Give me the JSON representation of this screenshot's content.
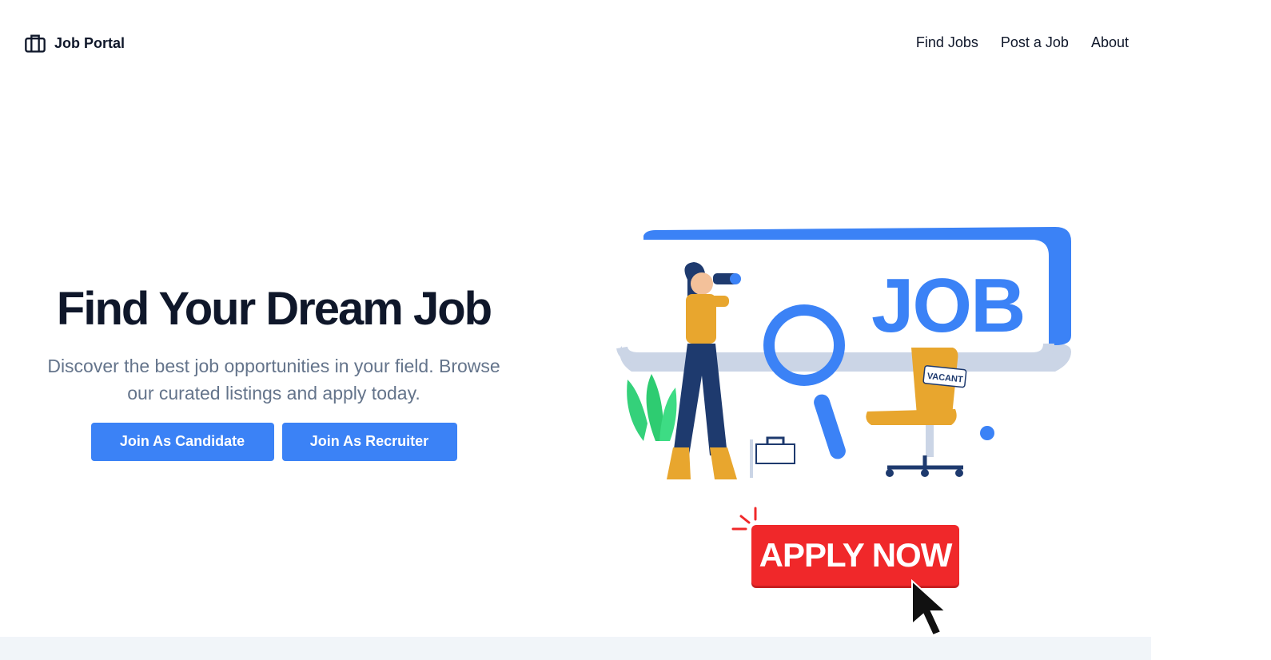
{
  "brand": {
    "name": "Job Portal",
    "icon": "briefcase-icon"
  },
  "nav": {
    "items": [
      "Find Jobs",
      "Post a Job",
      "About"
    ]
  },
  "hero": {
    "title": "Find Your Dream Job",
    "subtitle_line1": "Discover the best job opportunities in your field. Browse",
    "subtitle_line2": "our curated listings and apply today.",
    "buttons": {
      "candidate": "Join As Candidate",
      "recruiter": "Join As Recruiter"
    }
  },
  "illustration": {
    "banner_text": "JOB",
    "tag_text": "VACANT",
    "apply_label": "APPLY NOW"
  },
  "colors": {
    "accent": "#3b82f6",
    "apply_red": "#f0282a",
    "mustard": "#e8a62e",
    "navy": "#1e3a6e",
    "text": "#0f172a",
    "muted": "#64748b"
  }
}
